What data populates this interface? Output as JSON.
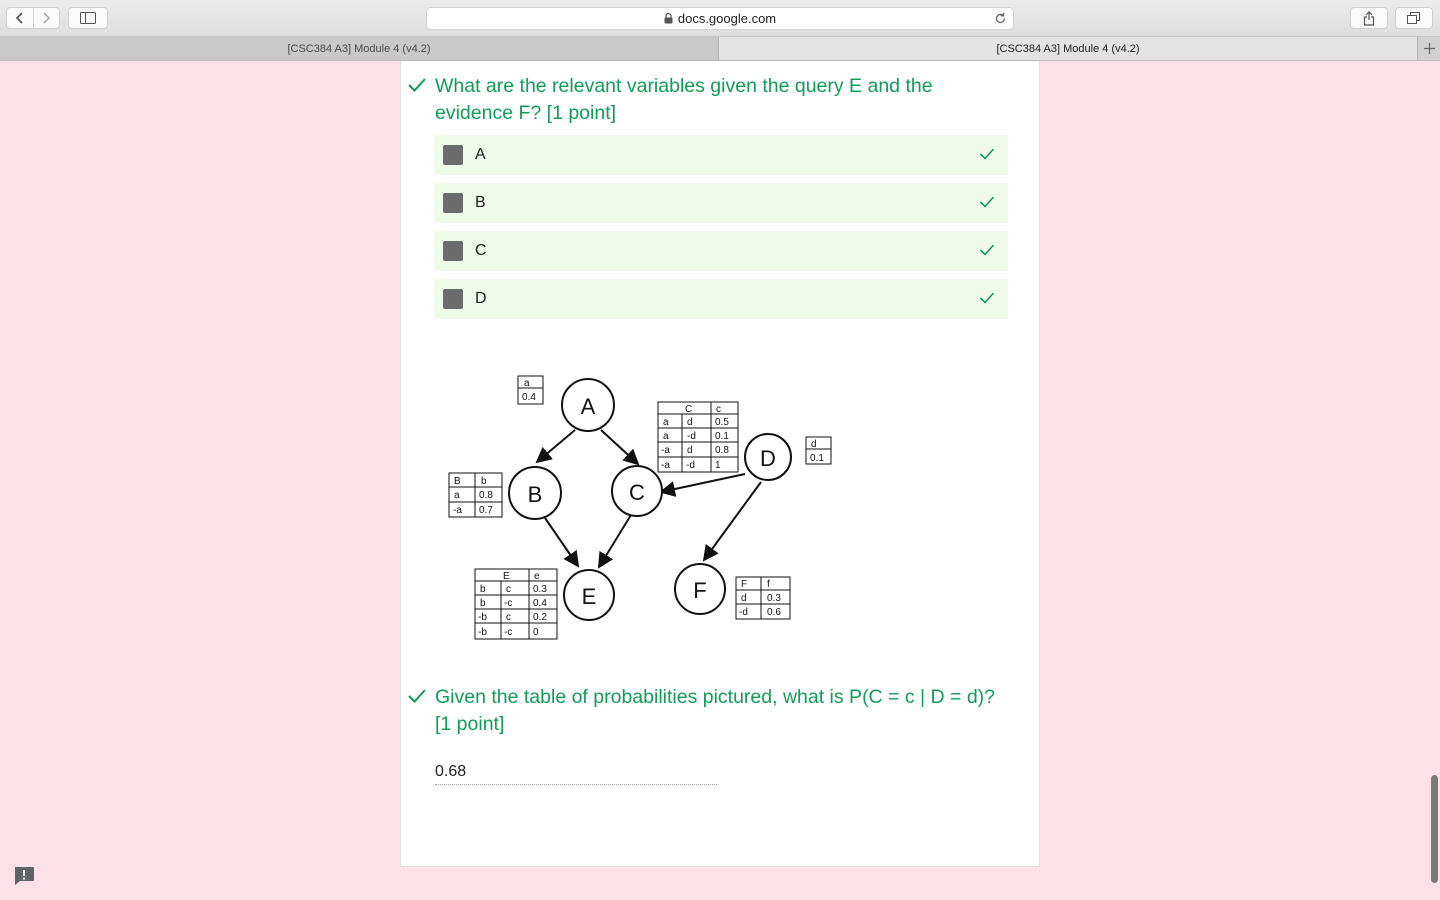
{
  "browser": {
    "address": "docs.google.com",
    "tabs": [
      {
        "label": "[CSC384 A3] Module 4 (v4.2)",
        "active": false
      },
      {
        "label": "[CSC384 A3] Module 4 (v4.2)",
        "active": true
      }
    ]
  },
  "form": {
    "question1": {
      "title": "What are the relevant variables given the query E and the evidence F? [1 point]",
      "options": [
        {
          "label": "A",
          "checked": true,
          "correct": true
        },
        {
          "label": "B",
          "checked": true,
          "correct": true
        },
        {
          "label": "C",
          "checked": true,
          "correct": true
        },
        {
          "label": "D",
          "checked": true,
          "correct": true
        }
      ]
    },
    "figure": {
      "nodes": [
        "A",
        "B",
        "C",
        "D",
        "E",
        "F"
      ],
      "table_a": {
        "header": "a",
        "values": [
          "0.4"
        ]
      },
      "table_d": {
        "header": "d",
        "values": [
          "0.1"
        ]
      },
      "table_b": {
        "header": [
          "B",
          "b"
        ],
        "rows": [
          [
            "a",
            "0.8"
          ],
          [
            "-a",
            "0.7"
          ]
        ]
      },
      "table_c": {
        "header": [
          "C",
          "c"
        ],
        "rows": [
          [
            "a",
            "d",
            "0.5"
          ],
          [
            "a",
            "-d",
            "0.1"
          ],
          [
            "-a",
            "d",
            "0.8"
          ],
          [
            "-a",
            "-d",
            "1"
          ]
        ]
      },
      "table_e": {
        "header": [
          "E",
          "e"
        ],
        "rows": [
          [
            "b",
            "c",
            "0.3"
          ],
          [
            "b",
            "-c",
            "0.4"
          ],
          [
            "-b",
            "c",
            "0.2"
          ],
          [
            "-b",
            "-c",
            "0"
          ]
        ]
      },
      "table_f": {
        "header": [
          "F",
          "f"
        ],
        "rows": [
          [
            "d",
            "0.3"
          ],
          [
            "-d",
            "0.6"
          ]
        ]
      }
    },
    "question2": {
      "title": "Given the table of probabilities pictured, what is P(C = c | D = d)? [1 point]",
      "answer": "0.68"
    }
  },
  "colors": {
    "correct_green": "#0f9d58",
    "option_bg": "#effaea",
    "page_bg": "#fde0e8"
  }
}
